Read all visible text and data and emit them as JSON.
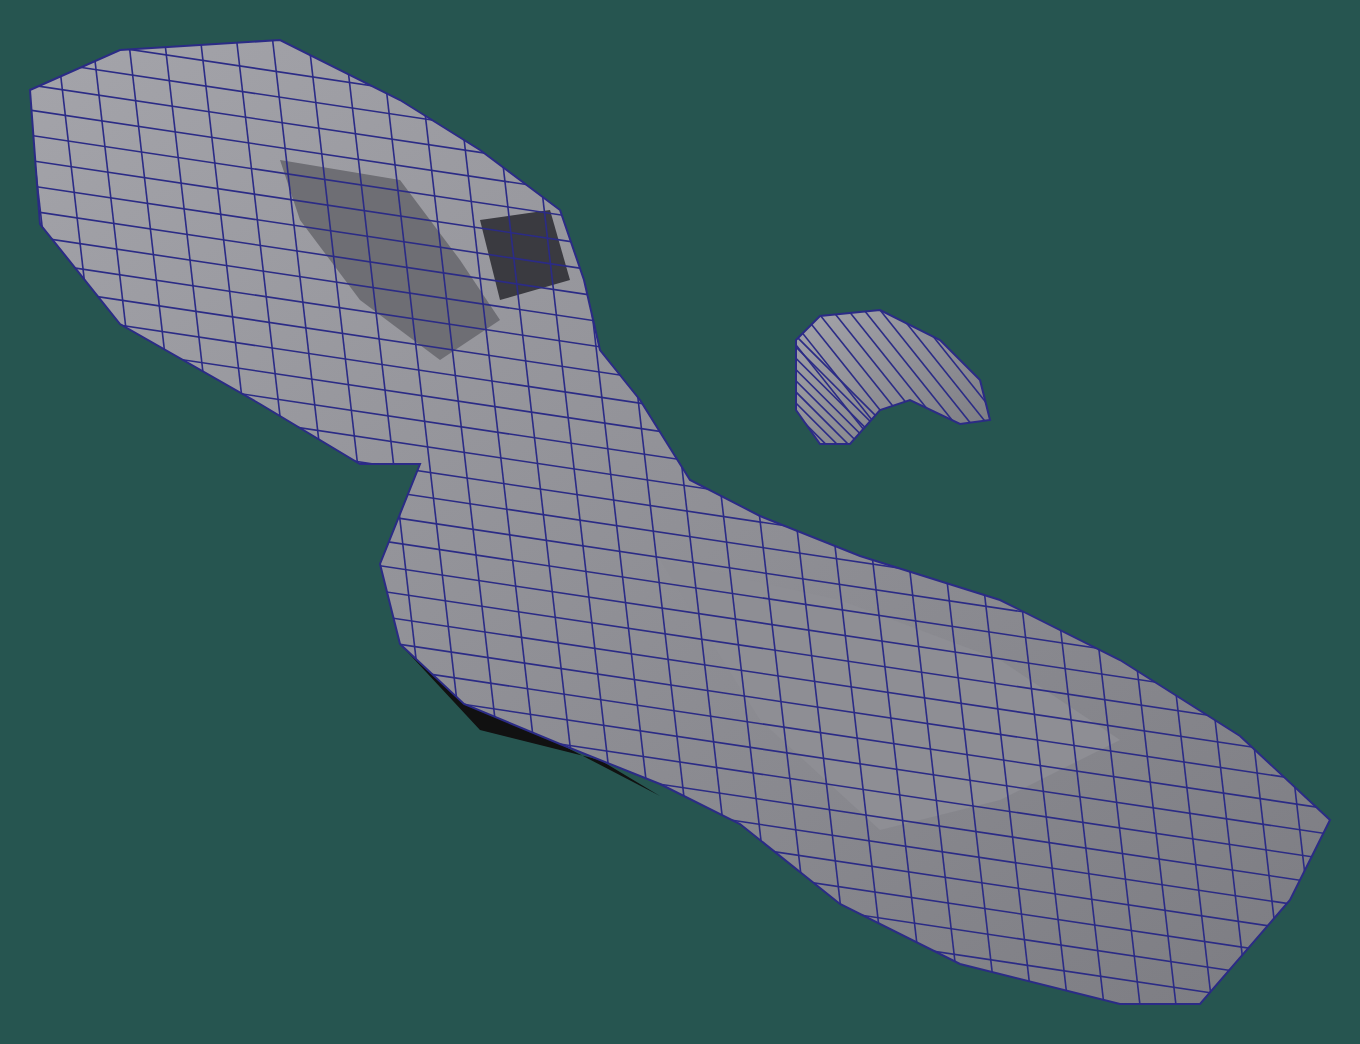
{
  "viewport": {
    "kind": "shaded-wireframe"
  }
}
